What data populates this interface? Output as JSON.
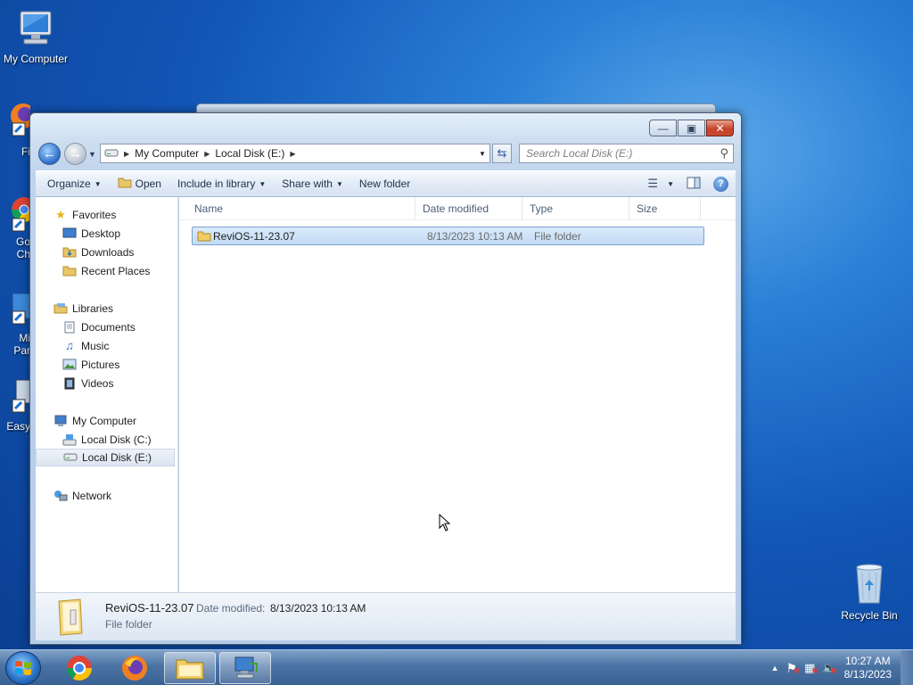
{
  "desktop": {
    "icons": [
      {
        "label": "My Computer"
      },
      {
        "label": "Recycle Bin"
      }
    ],
    "partial_labels": [
      "Fi",
      "Go",
      "Ch",
      "Mi",
      "Par",
      "Easy"
    ]
  },
  "window": {
    "address": {
      "crumbs": [
        "My Computer",
        "Local Disk (E:)"
      ]
    },
    "search": {
      "placeholder": "Search Local Disk (E:)"
    },
    "commands": {
      "organize": "Organize",
      "open": "Open",
      "include": "Include in library",
      "share": "Share with",
      "new_folder": "New folder"
    },
    "nav": {
      "favorites": "Favorites",
      "desktop": "Desktop",
      "downloads": "Downloads",
      "recent": "Recent Places",
      "libraries": "Libraries",
      "documents": "Documents",
      "music": "Music",
      "pictures": "Pictures",
      "videos": "Videos",
      "computer": "My Computer",
      "disk_c": "Local Disk (C:)",
      "disk_e": "Local Disk (E:)",
      "network": "Network"
    },
    "columns": [
      "Name",
      "Date modified",
      "Type",
      "Size"
    ],
    "files": [
      {
        "name": "ReviOS-11-23.07",
        "date": "8/13/2023 10:13 AM",
        "type": "File folder",
        "size": ""
      }
    ],
    "details": {
      "name": "ReviOS-11-23.07",
      "date_label": "Date modified:",
      "date": "8/13/2023 10:13 AM",
      "type": "File folder"
    }
  },
  "taskbar": {
    "time": "10:27 AM",
    "date": "8/13/2023"
  }
}
